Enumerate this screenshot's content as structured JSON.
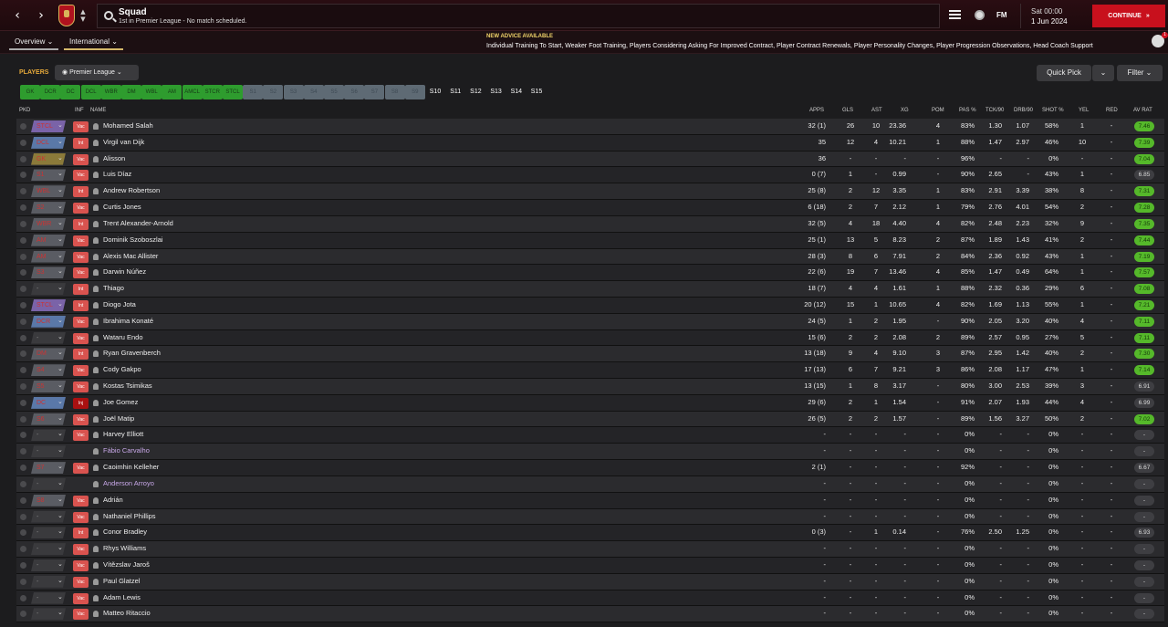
{
  "header": {
    "title": "Squad",
    "subtitle": "1st in Premier League - No match scheduled.",
    "date_day": "Sat 00:00",
    "date_full": "1 Jun 2024",
    "continue_label": "CONTINUE",
    "fm_label": "FM",
    "back_icon": "‹",
    "forward_icon": "›"
  },
  "tabs": [
    {
      "label": "Overview ⌄"
    },
    {
      "label": "International ⌄"
    }
  ],
  "advice": {
    "heading": "NEW ADVICE AVAILABLE",
    "text": "Individual Training To Start, Weaker Foot Training, Players Considering Asking For Improved Contract, Player Contract Renewals, Player Personality Changes, Player Progression Observations, Head Coach Support",
    "badge": "1"
  },
  "filters": {
    "players_label": "PLAYERS",
    "league": "Premier League",
    "quick_pick": "Quick Pick",
    "filter": "Filter"
  },
  "positions": [
    "GK",
    "DCR",
    "DC",
    "DCL",
    "WBR",
    "DM",
    "WBL",
    "AM",
    "AMCL",
    "STCR",
    "STCL",
    "S1",
    "S2",
    "S3",
    "S4",
    "S5",
    "S6",
    "S7",
    "S8",
    "S9",
    "S10",
    "S11",
    "S12",
    "S13",
    "S14",
    "S15"
  ],
  "columns": {
    "pkd": "PKD",
    "inf": "INF",
    "name": "NAME",
    "apps": "APPS",
    "gls": "GLS",
    "ast": "AST",
    "xg": "XG",
    "pom": "POM",
    "pas": "PAS %",
    "tck": "TCK/90",
    "drb": "DRB/90",
    "shot": "SHOT %",
    "yel": "YEL",
    "red": "RED",
    "avrat": "AV RAT"
  },
  "colors": {
    "accent": "#c8101d",
    "green": "#2e9c2e",
    "rating_green": "#55b82a"
  },
  "players": [
    {
      "role": "STCL",
      "inf": "Vac",
      "name": "Mohamed Salah",
      "apps": "32 (1)",
      "gls": "26",
      "ast": "10",
      "xg": "23.36",
      "pom": "4",
      "pas": "83%",
      "tck": "1.30",
      "drb": "1.07",
      "shot": "58%",
      "yel": "1",
      "red": "-",
      "avrat": "7.46"
    },
    {
      "role": "DCL",
      "inf": "Int",
      "name": "Virgil van Dijk",
      "apps": "35",
      "gls": "12",
      "ast": "4",
      "xg": "10.21",
      "pom": "1",
      "pas": "88%",
      "tck": "1.47",
      "drb": "2.97",
      "shot": "46%",
      "yel": "10",
      "red": "-",
      "avrat": "7.39"
    },
    {
      "role": "GK",
      "inf": "Vac",
      "name": "Alisson",
      "apps": "36",
      "gls": "-",
      "ast": "-",
      "xg": "-",
      "pom": "-",
      "pas": "96%",
      "tck": "-",
      "drb": "-",
      "shot": "0%",
      "yel": "-",
      "red": "-",
      "avrat": "7.04"
    },
    {
      "role": "S1",
      "inf": "Vac",
      "name": "Luis Díaz",
      "apps": "0 (7)",
      "gls": "1",
      "ast": "-",
      "xg": "0.99",
      "pom": "-",
      "pas": "90%",
      "tck": "2.65",
      "drb": "-",
      "shot": "43%",
      "yel": "1",
      "red": "-",
      "avrat": "6.85"
    },
    {
      "role": "WBL",
      "inf": "Int",
      "name": "Andrew Robertson",
      "apps": "25 (8)",
      "gls": "2",
      "ast": "12",
      "xg": "3.35",
      "pom": "1",
      "pas": "83%",
      "tck": "2.91",
      "drb": "3.39",
      "shot": "38%",
      "yel": "8",
      "red": "-",
      "avrat": "7.31"
    },
    {
      "role": "S2",
      "inf": "Vac",
      "name": "Curtis Jones",
      "apps": "6 (18)",
      "gls": "2",
      "ast": "7",
      "xg": "2.12",
      "pom": "1",
      "pas": "79%",
      "tck": "2.76",
      "drb": "4.01",
      "shot": "54%",
      "yel": "2",
      "red": "-",
      "avrat": "7.28"
    },
    {
      "role": "WBR",
      "inf": "Int",
      "name": "Trent Alexander-Arnold",
      "apps": "32 (5)",
      "gls": "4",
      "ast": "18",
      "xg": "4.40",
      "pom": "4",
      "pas": "82%",
      "tck": "2.48",
      "drb": "2.23",
      "shot": "32%",
      "yel": "9",
      "red": "-",
      "avrat": "7.35"
    },
    {
      "role": "AM",
      "inf": "Vac",
      "name": "Dominik Szoboszlai",
      "apps": "25 (1)",
      "gls": "13",
      "ast": "5",
      "xg": "8.23",
      "pom": "2",
      "pas": "87%",
      "tck": "1.89",
      "drb": "1.43",
      "shot": "41%",
      "yel": "2",
      "red": "-",
      "avrat": "7.44"
    },
    {
      "role": "AM",
      "inf": "Vac",
      "name": "Alexis Mac Allister",
      "apps": "28 (3)",
      "gls": "8",
      "ast": "6",
      "xg": "7.91",
      "pom": "2",
      "pas": "84%",
      "tck": "2.36",
      "drb": "0.92",
      "shot": "43%",
      "yel": "1",
      "red": "-",
      "avrat": "7.19"
    },
    {
      "role": "S3",
      "inf": "Vac",
      "name": "Darwin Núñez",
      "apps": "22 (6)",
      "gls": "19",
      "ast": "7",
      "xg": "13.46",
      "pom": "4",
      "pas": "85%",
      "tck": "1.47",
      "drb": "0.49",
      "shot": "64%",
      "yel": "1",
      "red": "-",
      "avrat": "7.57"
    },
    {
      "role": "-",
      "inf": "Int",
      "name": "Thiago",
      "apps": "18 (7)",
      "gls": "4",
      "ast": "4",
      "xg": "1.61",
      "pom": "1",
      "pas": "88%",
      "tck": "2.32",
      "drb": "0.36",
      "shot": "29%",
      "yel": "6",
      "red": "-",
      "avrat": "7.08"
    },
    {
      "role": "STCL",
      "inf": "Int",
      "name": "Diogo Jota",
      "apps": "20 (12)",
      "gls": "15",
      "ast": "1",
      "xg": "10.65",
      "pom": "4",
      "pas": "82%",
      "tck": "1.69",
      "drb": "1.13",
      "shot": "55%",
      "yel": "1",
      "red": "-",
      "avrat": "7.21"
    },
    {
      "role": "DCR",
      "inf": "Vac",
      "name": "Ibrahima Konaté",
      "apps": "24 (5)",
      "gls": "1",
      "ast": "2",
      "xg": "1.95",
      "pom": "-",
      "pas": "90%",
      "tck": "2.05",
      "drb": "3.20",
      "shot": "40%",
      "yel": "4",
      "red": "-",
      "avrat": "7.11"
    },
    {
      "role": "-",
      "inf": "Vac",
      "name": "Wataru Endo",
      "apps": "15 (6)",
      "gls": "2",
      "ast": "2",
      "xg": "2.08",
      "pom": "2",
      "pas": "89%",
      "tck": "2.57",
      "drb": "0.95",
      "shot": "27%",
      "yel": "5",
      "red": "-",
      "avrat": "7.11"
    },
    {
      "role": "DM",
      "inf": "Int",
      "name": "Ryan Gravenberch",
      "apps": "13 (18)",
      "gls": "9",
      "ast": "4",
      "xg": "9.10",
      "pom": "3",
      "pas": "87%",
      "tck": "2.95",
      "drb": "1.42",
      "shot": "40%",
      "yel": "2",
      "red": "-",
      "avrat": "7.30"
    },
    {
      "role": "S4",
      "inf": "Vac",
      "name": "Cody Gakpo",
      "apps": "17 (13)",
      "gls": "6",
      "ast": "7",
      "xg": "9.21",
      "pom": "3",
      "pas": "86%",
      "tck": "2.08",
      "drb": "1.17",
      "shot": "47%",
      "yel": "1",
      "red": "-",
      "avrat": "7.14"
    },
    {
      "role": "S5",
      "inf": "Vac",
      "name": "Kostas Tsimikas",
      "apps": "13 (15)",
      "gls": "1",
      "ast": "8",
      "xg": "3.17",
      "pom": "-",
      "pas": "80%",
      "tck": "3.00",
      "drb": "2.53",
      "shot": "39%",
      "yel": "3",
      "red": "-",
      "avrat": "6.91"
    },
    {
      "role": "DC",
      "inf": "Inj",
      "name": "Joe Gomez",
      "apps": "29 (6)",
      "gls": "2",
      "ast": "1",
      "xg": "1.54",
      "pom": "-",
      "pas": "91%",
      "tck": "2.07",
      "drb": "1.93",
      "shot": "44%",
      "yel": "4",
      "red": "-",
      "avrat": "6.99"
    },
    {
      "role": "S6",
      "inf": "Vac",
      "name": "Joël Matip",
      "apps": "26 (5)",
      "gls": "2",
      "ast": "2",
      "xg": "1.57",
      "pom": "-",
      "pas": "89%",
      "tck": "1.56",
      "drb": "3.27",
      "shot": "50%",
      "yel": "2",
      "red": "-",
      "avrat": "7.02"
    },
    {
      "role": "-",
      "inf": "Vac",
      "name": "Harvey Elliott",
      "apps": "-",
      "gls": "-",
      "ast": "-",
      "xg": "-",
      "pom": "-",
      "pas": "0%",
      "tck": "-",
      "drb": "-",
      "shot": "0%",
      "yel": "-",
      "red": "-",
      "avrat": "-"
    },
    {
      "role": "-",
      "inf": "",
      "name": "Fábio Carvalho",
      "apps": "-",
      "gls": "-",
      "ast": "-",
      "xg": "-",
      "pom": "-",
      "pas": "0%",
      "tck": "-",
      "drb": "-",
      "shot": "0%",
      "yel": "-",
      "red": "-",
      "avrat": "-",
      "loan": true
    },
    {
      "role": "S7",
      "inf": "Vac",
      "name": "Caoimhin Kelleher",
      "apps": "2 (1)",
      "gls": "-",
      "ast": "-",
      "xg": "-",
      "pom": "-",
      "pas": "92%",
      "tck": "-",
      "drb": "-",
      "shot": "0%",
      "yel": "-",
      "red": "-",
      "avrat": "6.67"
    },
    {
      "role": "-",
      "inf": "",
      "name": "Anderson Arroyo",
      "apps": "-",
      "gls": "-",
      "ast": "-",
      "xg": "-",
      "pom": "-",
      "pas": "0%",
      "tck": "-",
      "drb": "-",
      "shot": "0%",
      "yel": "-",
      "red": "-",
      "avrat": "-",
      "loan": true
    },
    {
      "role": "S8",
      "inf": "Vac",
      "name": "Adrián",
      "apps": "-",
      "gls": "-",
      "ast": "-",
      "xg": "-",
      "pom": "-",
      "pas": "0%",
      "tck": "-",
      "drb": "-",
      "shot": "0%",
      "yel": "-",
      "red": "-",
      "avrat": "-"
    },
    {
      "role": "-",
      "inf": "Vac",
      "name": "Nathaniel Phillips",
      "apps": "-",
      "gls": "-",
      "ast": "-",
      "xg": "-",
      "pom": "-",
      "pas": "0%",
      "tck": "-",
      "drb": "-",
      "shot": "0%",
      "yel": "-",
      "red": "-",
      "avrat": "-"
    },
    {
      "role": "-",
      "inf": "Int",
      "name": "Conor Bradley",
      "apps": "0 (3)",
      "gls": "-",
      "ast": "1",
      "xg": "0.14",
      "pom": "-",
      "pas": "76%",
      "tck": "2.50",
      "drb": "1.25",
      "shot": "0%",
      "yel": "-",
      "red": "-",
      "avrat": "6.93"
    },
    {
      "role": "-",
      "inf": "Vac",
      "name": "Rhys Williams",
      "apps": "-",
      "gls": "-",
      "ast": "-",
      "xg": "-",
      "pom": "-",
      "pas": "0%",
      "tck": "-",
      "drb": "-",
      "shot": "0%",
      "yel": "-",
      "red": "-",
      "avrat": "-"
    },
    {
      "role": "-",
      "inf": "Vac",
      "name": "Vítězslav Jaroš",
      "apps": "-",
      "gls": "-",
      "ast": "-",
      "xg": "-",
      "pom": "-",
      "pas": "0%",
      "tck": "-",
      "drb": "-",
      "shot": "0%",
      "yel": "-",
      "red": "-",
      "avrat": "-"
    },
    {
      "role": "-",
      "inf": "Vac",
      "name": "Paul Glatzel",
      "apps": "-",
      "gls": "-",
      "ast": "-",
      "xg": "-",
      "pom": "-",
      "pas": "0%",
      "tck": "-",
      "drb": "-",
      "shot": "0%",
      "yel": "-",
      "red": "-",
      "avrat": "-"
    },
    {
      "role": "-",
      "inf": "Vac",
      "name": "Adam Lewis",
      "apps": "-",
      "gls": "-",
      "ast": "-",
      "xg": "-",
      "pom": "-",
      "pas": "0%",
      "tck": "-",
      "drb": "-",
      "shot": "0%",
      "yel": "-",
      "red": "-",
      "avrat": "-"
    },
    {
      "role": "-",
      "inf": "Vac",
      "name": "Matteo Ritaccio",
      "apps": "-",
      "gls": "-",
      "ast": "-",
      "xg": "-",
      "pom": "-",
      "pas": "0%",
      "tck": "-",
      "drb": "-",
      "shot": "0%",
      "yel": "-",
      "red": "-",
      "avrat": "-"
    }
  ]
}
